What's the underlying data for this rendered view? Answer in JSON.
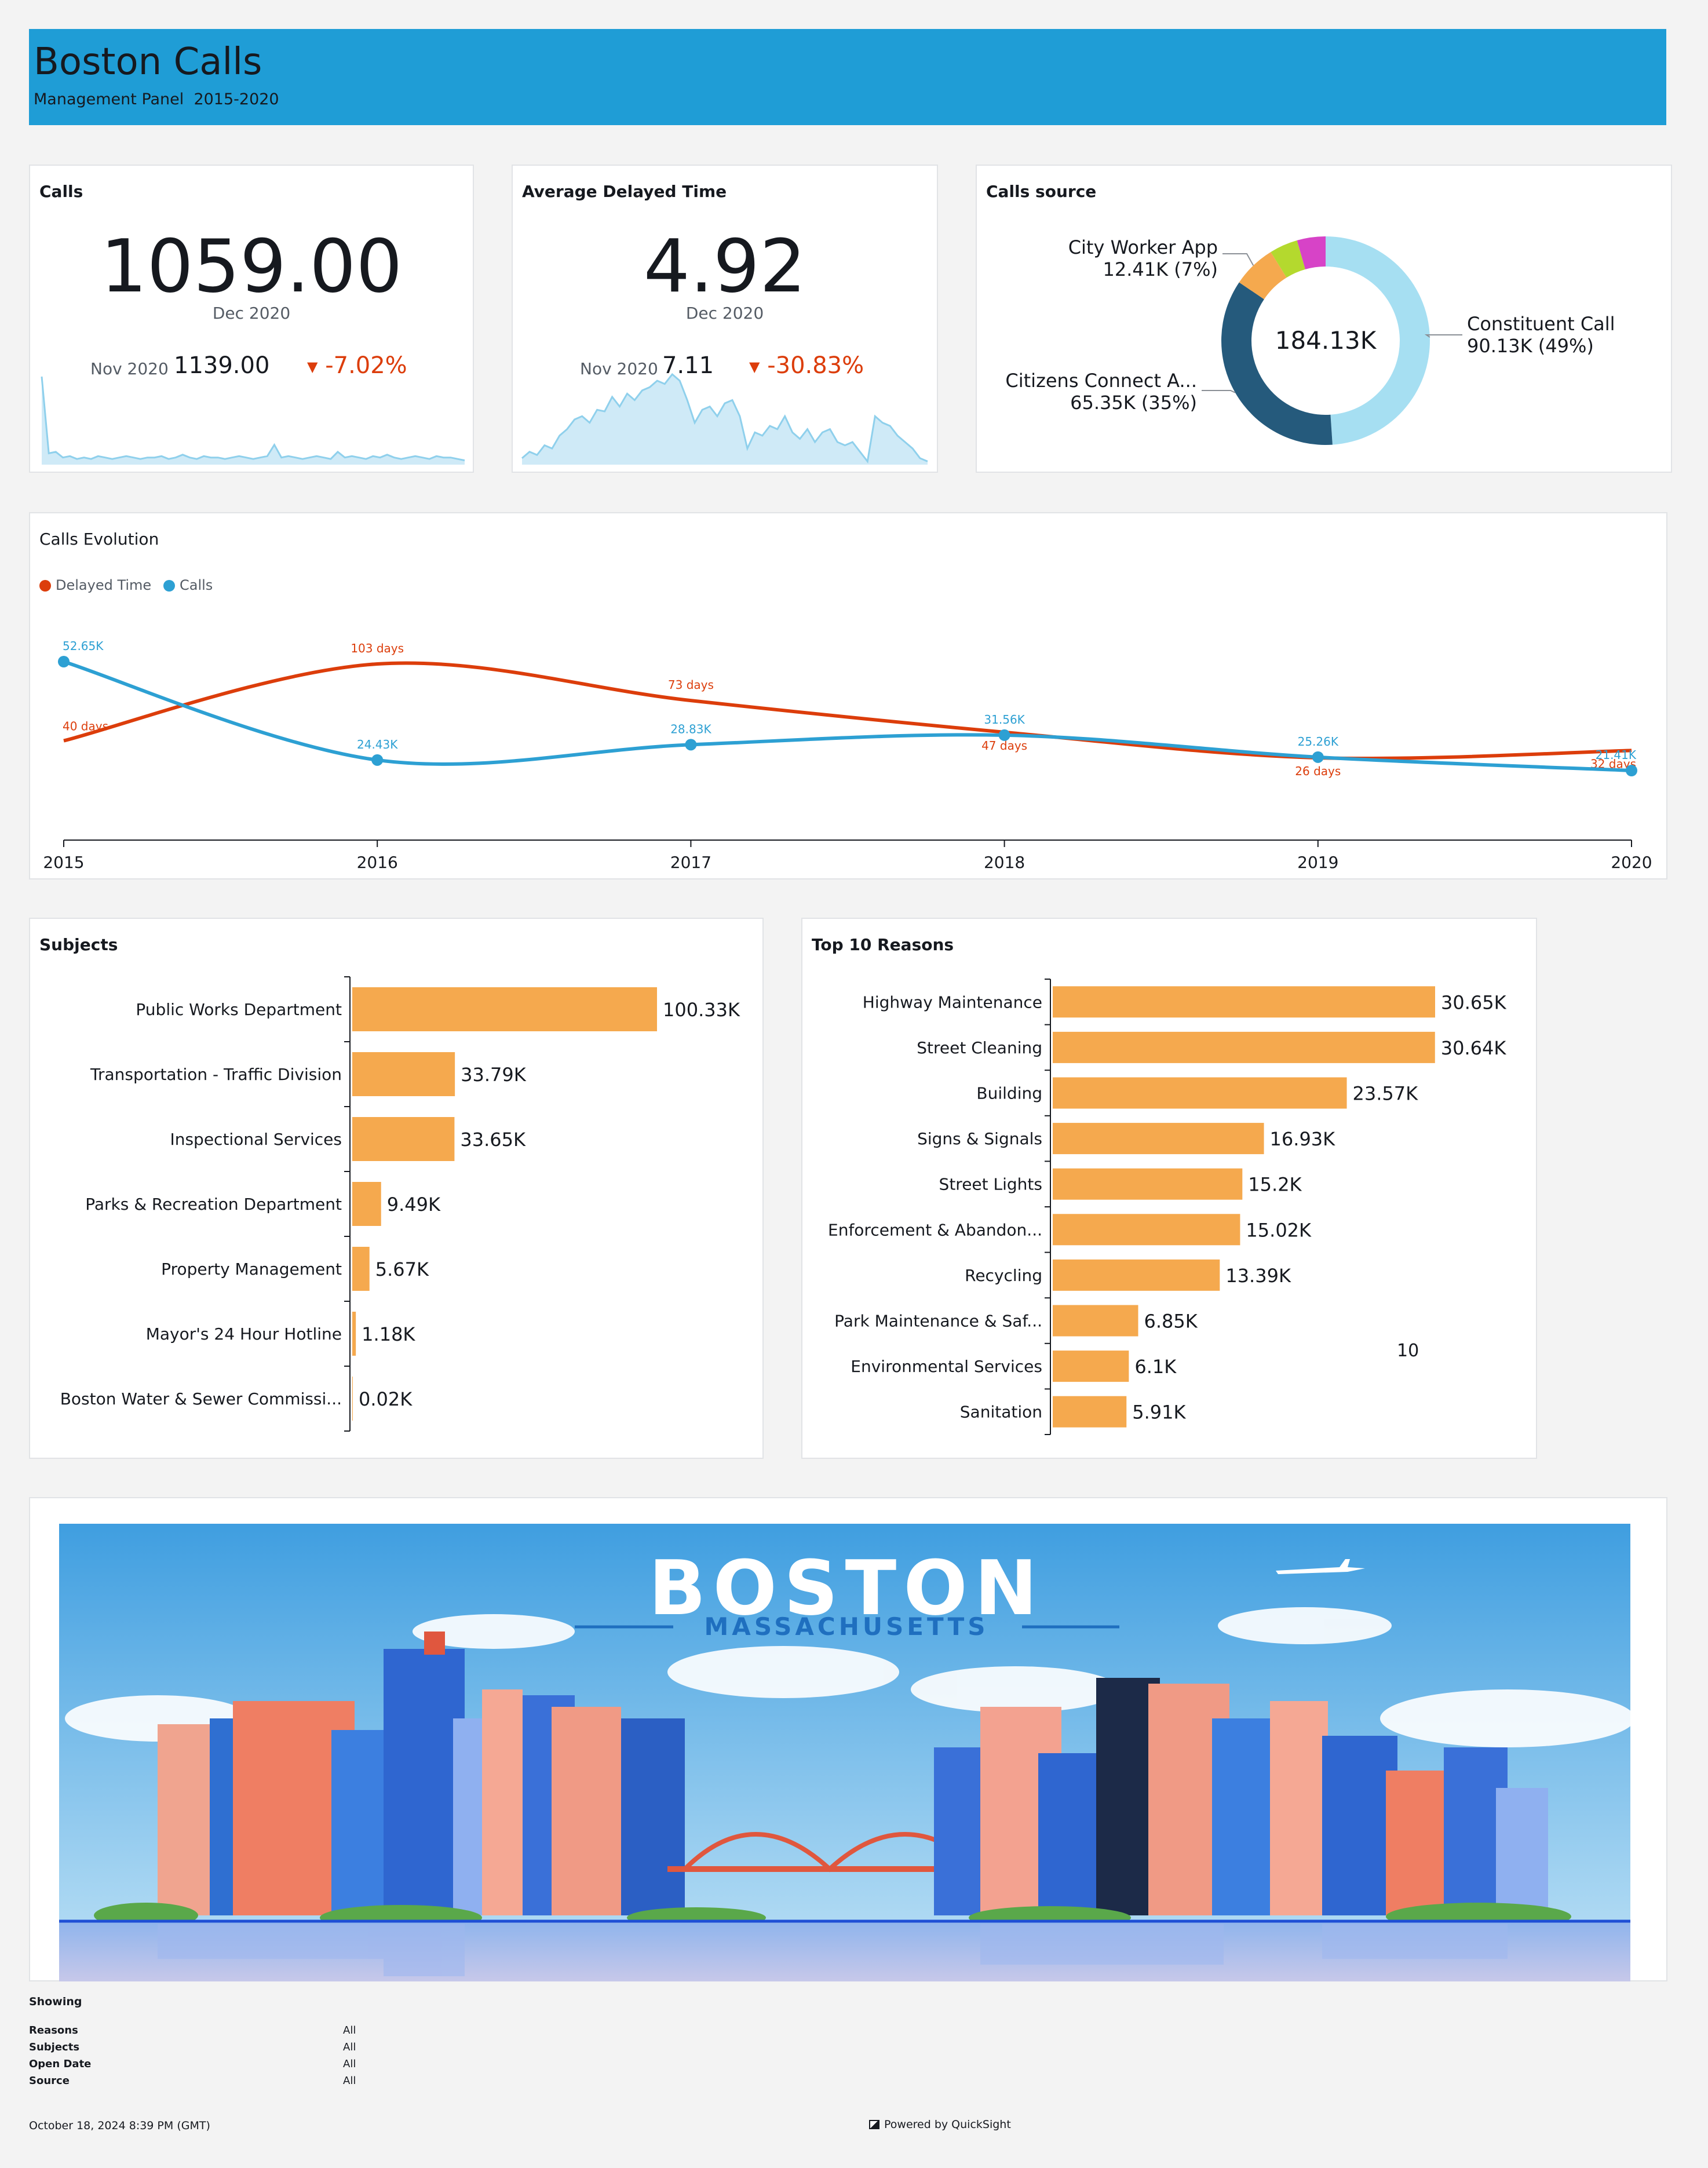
{
  "header": {
    "title": "Boston Calls",
    "subtitle": "Management Panel  2015-2020",
    "bg_color": "#1f9dd6"
  },
  "kpi_calls": {
    "title": "Calls",
    "value": "1059.00",
    "period": "Dec 2020",
    "compare_period": "Nov 2020",
    "compare_value": "1139.00",
    "change": "-7.02%",
    "sparkline": [
      62,
      8,
      9,
      5,
      6,
      4,
      5,
      4,
      6,
      5,
      4,
      5,
      6,
      5,
      4,
      5,
      5,
      6,
      4,
      5,
      7,
      5,
      4,
      6,
      5,
      5,
      4,
      5,
      6,
      5,
      4,
      5,
      6,
      14,
      5,
      6,
      5,
      4,
      5,
      6,
      5,
      4,
      9,
      5,
      6,
      5,
      4,
      6,
      5,
      7,
      5,
      4,
      5,
      6,
      5,
      4,
      6,
      5,
      5,
      4,
      3
    ]
  },
  "kpi_delay": {
    "title": "Average Delayed Time",
    "value": "4.92",
    "period": "Dec 2020",
    "compare_period": "Nov 2020",
    "compare_value": "7.11",
    "change": "-30.83%",
    "sparkline": [
      4,
      8,
      6,
      12,
      10,
      18,
      22,
      28,
      30,
      26,
      34,
      33,
      42,
      36,
      44,
      40,
      46,
      48,
      52,
      50,
      56,
      52,
      40,
      26,
      34,
      36,
      30,
      38,
      40,
      30,
      10,
      20,
      18,
      24,
      22,
      30,
      20,
      16,
      22,
      14,
      20,
      22,
      14,
      12,
      14,
      8,
      2,
      30,
      26,
      24,
      18,
      14,
      10,
      4,
      2
    ]
  },
  "calls_source": {
    "title": "Calls source",
    "total": "184.13K",
    "slices": [
      {
        "name": "Constituent Call",
        "label": "90.13K (49%)",
        "value": 90.13,
        "color": "#a6dff2"
      },
      {
        "name": "Citizens Connect A...",
        "label": "65.35K (35%)",
        "value": 65.35,
        "color": "#255a7c"
      },
      {
        "name": "City Worker App",
        "label": "12.41K (7%)",
        "value": 12.41,
        "color": "#f5a94e"
      },
      {
        "name": "",
        "label": "",
        "value": 8.1,
        "color": "#b4d92e"
      },
      {
        "name": "",
        "label": "",
        "value": 8.14,
        "color": "#d743c7"
      }
    ]
  },
  "evolution": {
    "title": "Calls Evolution",
    "legend": [
      {
        "name": "Delayed Time",
        "color": "#dc3d0b"
      },
      {
        "name": "Calls",
        "color": "#2da0d3"
      }
    ]
  },
  "subjects": {
    "title": "Subjects"
  },
  "reasons": {
    "title": "Top 10 Reasons",
    "side_note": "10"
  },
  "banner": {
    "title": "BOSTON",
    "subtitle": "MASSACHUSETTS"
  },
  "footer": {
    "showing": "Showing",
    "filters": [
      {
        "name": "Reasons",
        "value": "All"
      },
      {
        "name": "Subjects",
        "value": "All"
      },
      {
        "name": "Open Date",
        "value": "All"
      },
      {
        "name": "Source",
        "value": "All"
      }
    ],
    "timestamp": "October 18, 2024 8:39 PM (GMT)",
    "powered": "Powered by QuickSight"
  },
  "chart_data": [
    {
      "type": "line",
      "title": "Calls Evolution",
      "x": [
        "2015",
        "2016",
        "2017",
        "2018",
        "2019",
        "2020"
      ],
      "series": [
        {
          "name": "Delayed Time",
          "values": [
            40,
            103,
            73,
            47,
            26,
            32
          ],
          "labels": [
            "40 days",
            "103 days",
            "73 days",
            "47 days",
            "26 days",
            "32 days"
          ],
          "color": "#dc3d0b"
        },
        {
          "name": "Calls",
          "values": [
            52.65,
            24.43,
            28.83,
            31.56,
            25.26,
            21.41
          ],
          "labels": [
            "52.65K",
            "24.43K",
            "28.83K",
            "31.56K",
            "25.26K",
            "21.41K"
          ],
          "color": "#2da0d3"
        }
      ]
    },
    {
      "type": "bar",
      "title": "Subjects",
      "categories": [
        "Public Works Department",
        "Transportation - Traffic Division",
        "Inspectional Services",
        "Parks & Recreation Department",
        "Property Management",
        "Mayor's 24 Hour Hotline",
        "Boston Water & Sewer Commissi..."
      ],
      "values": [
        100.33,
        33.79,
        33.65,
        9.49,
        5.67,
        1.18,
        0.02
      ],
      "labels": [
        "100.33K",
        "33.79K",
        "33.65K",
        "9.49K",
        "5.67K",
        "1.18K",
        "0.02K"
      ],
      "color": "#f5a94e"
    },
    {
      "type": "bar",
      "title": "Top 10 Reasons",
      "categories": [
        "Highway Maintenance",
        "Street Cleaning",
        "Building",
        "Signs & Signals",
        "Street Lights",
        "Enforcement & Abandon...",
        "Recycling",
        "Park Maintenance & Saf...",
        "Environmental Services",
        "Sanitation"
      ],
      "values": [
        30.65,
        30.64,
        23.57,
        16.93,
        15.2,
        15.02,
        13.39,
        6.85,
        6.1,
        5.91
      ],
      "labels": [
        "30.65K",
        "30.64K",
        "23.57K",
        "16.93K",
        "15.2K",
        "15.02K",
        "13.39K",
        "6.85K",
        "6.1K",
        "5.91K"
      ],
      "color": "#f5a94e"
    }
  ]
}
